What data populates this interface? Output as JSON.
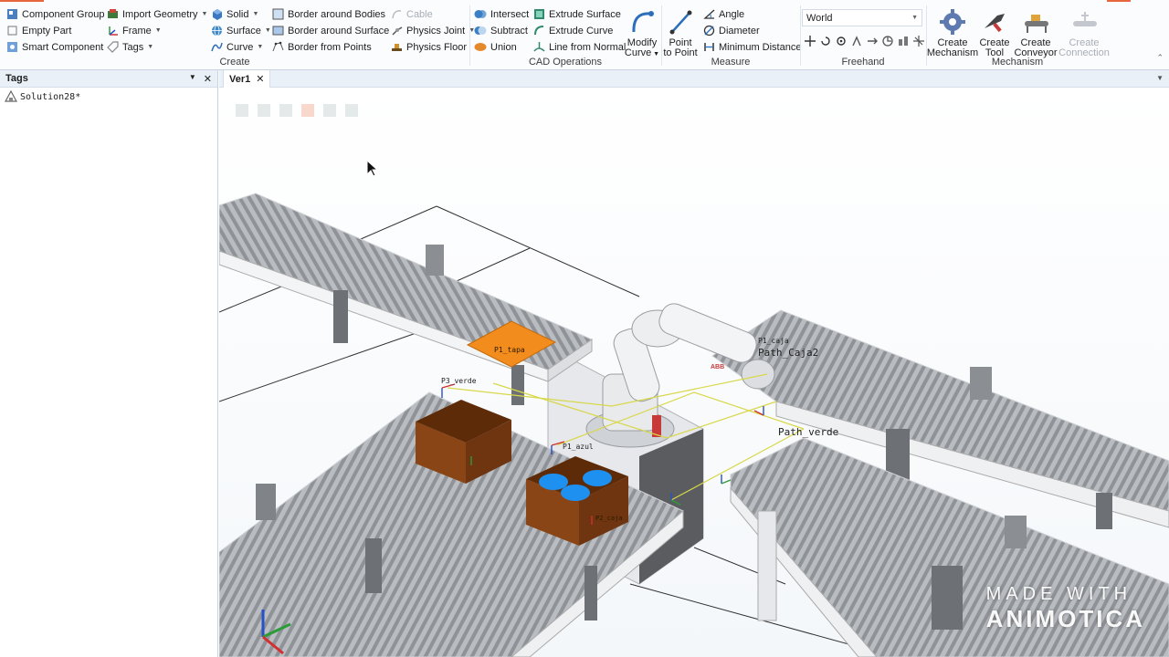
{
  "ribbon": {
    "create": {
      "label": "Create",
      "col1": [
        "Component Group",
        "Empty Part",
        "Smart Component"
      ],
      "col2": [
        "Import Geometry",
        "Frame",
        "Tags"
      ],
      "col3": [
        "Solid",
        "Surface",
        "Curve"
      ],
      "col4": [
        "Border around Bodies",
        "Border around Surface",
        "Border from Points"
      ],
      "col5": [
        "Cable",
        "Physics Joint",
        "Physics Floor"
      ]
    },
    "cad": {
      "label": "CAD Operations",
      "col1": [
        "Intersect",
        "Subtract",
        "Union"
      ],
      "col2": [
        "Extrude Surface",
        "Extrude Curve",
        "Line from Normal"
      ],
      "modify_curve": [
        "Modify",
        "Curve"
      ]
    },
    "measure": {
      "label": "Measure",
      "point_to_point": [
        "Point",
        "to Point"
      ],
      "items": [
        "Angle",
        "Diameter",
        "Minimum Distance"
      ]
    },
    "freehand": {
      "label": "Freehand",
      "reference": "World"
    },
    "mechanism": {
      "label": "Mechanism",
      "buttons": [
        [
          "Create",
          "Mechanism"
        ],
        [
          "Create",
          "Tool"
        ],
        [
          "Create",
          "Conveyor"
        ],
        [
          "Create",
          "Connection"
        ]
      ]
    }
  },
  "left_pane": {
    "title": "Tags",
    "tree": [
      "Solution28*"
    ]
  },
  "viewport": {
    "tab": "Ver1",
    "labels": [
      "P1_tapa",
      "P1_caja",
      "Path_Caja2",
      "P3_verde",
      "Path_verde",
      "P1_azul",
      "P2_caja"
    ],
    "watermark": [
      "MADE WITH",
      "ANIMOTICA"
    ]
  },
  "colors": {
    "ribbon_bg": "#fbfcfe",
    "accent": "#e8663d",
    "box_brown": "#7a3c10",
    "lid_orange": "#f28c1c",
    "parts_blue": "#1e90f0"
  }
}
